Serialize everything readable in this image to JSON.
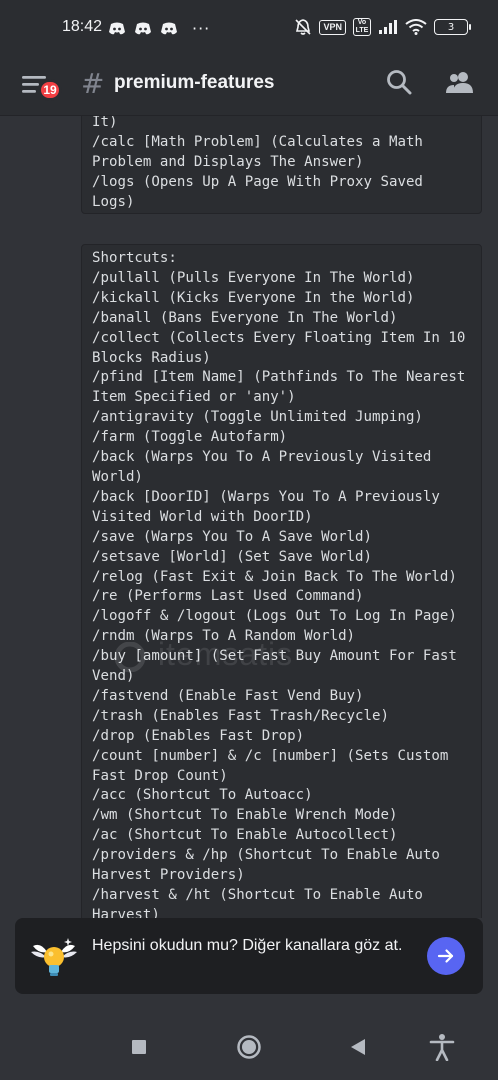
{
  "status_bar": {
    "time": "18:42",
    "more": "···",
    "vpn": "VPN",
    "volte": "Vo LTE",
    "battery": "3"
  },
  "header": {
    "notification_count": "19",
    "hash": "#",
    "channel_name": "premium-features"
  },
  "message_1": {
    "lines": [
      "It)",
      "/calc [Math Problem] (Calculates a Math",
      "Problem and Displays The Answer)",
      "/logs (Opens Up A Page With Proxy Saved",
      "Logs)"
    ]
  },
  "message_2": {
    "lines": [
      "Shortcuts:",
      "/pullall (Pulls Everyone In The World)",
      "/kickall (Kicks Everyone In the World)",
      "/banall (Bans Everyone In The World)",
      "/collect (Collects Every Floating Item In 10",
      "Blocks Radius)",
      "/pfind [Item Name] (Pathfinds To The Nearest",
      "Item Specified or 'any')",
      "/antigravity (Toggle Unlimited Jumping)",
      "/farm (Toggle Autofarm)",
      "/back (Warps You To A Previously Visited",
      "World)",
      "/back [DoorID] (Warps You To A Previously",
      "Visited World with DoorID)",
      "/save (Warps You To A Save World)",
      "/setsave [World] (Set Save World)",
      "/relog (Fast Exit & Join Back To The World)",
      "/re (Performs Last Used Command)",
      "/logoff & /logout (Logs Out To Log In Page)",
      "/rndm (Warps To A Random World)",
      "/buy [amount] (Set Fast Buy Amount For Fast",
      "Vend)",
      "/fastvend (Enable Fast Vend Buy)",
      "/trash (Enables Fast Trash/Recycle)",
      "/drop (Enables Fast Drop)",
      "/count [number] & /c [number] (Sets Custom",
      "Fast Drop Count)",
      "/acc (Shortcut To Autoacc)",
      "/wm (Shortcut To Enable Wrench Mode)",
      "/ac (Shortcut To Enable Autocollect)",
      "/providers & /hp (Shortcut To Enable Auto",
      "Harvest Providers)",
      "/harvest & /ht (Shortcut To Enable Auto",
      "Harvest)"
    ]
  },
  "watermark": "itemsatis",
  "banner": {
    "text": "Hepsini okudun mu? Diğer kanallara göz at."
  },
  "colors": {
    "background": "#313338",
    "header": "#2b2d31",
    "code_bg": "#2b2d31",
    "banner_bg": "#1e1f22",
    "accent": "#5865f2",
    "badge": "#f23f43"
  }
}
